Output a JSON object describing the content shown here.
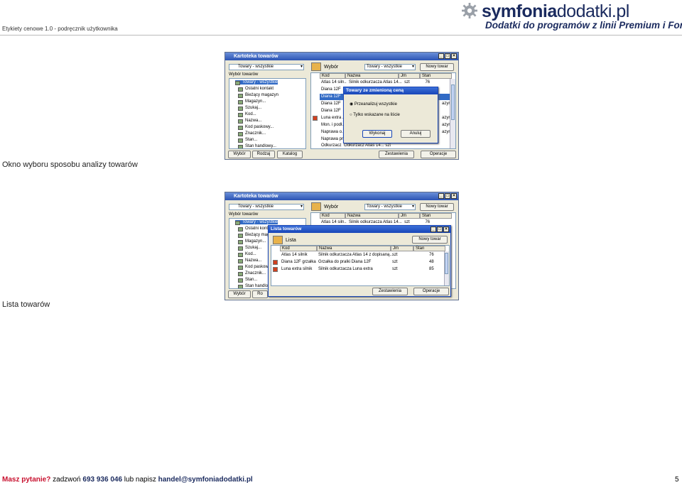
{
  "header": {
    "doc_title": "Etykiety cenowe 1.0  - podręcznik użytkownika",
    "logo_brand_bold": "symfonia",
    "logo_brand_thin": "dodatki.pl",
    "logo_tagline": "Dodatki do programów z linii Premium i Forte"
  },
  "captions": {
    "first": "Okno wyboru sposobu analizy towarów",
    "second": "Lista towarów"
  },
  "footer": {
    "question": "Masz pytanie?",
    "call_text": "zadzwoń",
    "phone": "693 936 046",
    "or_text": "lub napisz",
    "email": "handel@symfoniadodatki.pl",
    "page_number": "5"
  },
  "screenshot1": {
    "window_title": "Kartoteka towarów",
    "filter_combo": "Towary - wszystkie",
    "label_wybor_towarow": "Wybór towarów",
    "tree_items": [
      "Towary - wszystkie",
      "Ostatni kontakt",
      "Bieżący magazyn",
      "Magazyn...",
      "Szukaj...",
      "Kod...",
      "Nazwa...",
      "Kod paskowy...",
      "Znacznik...",
      "Stan...",
      "Stan handlowy..."
    ],
    "right_header": "Wybór",
    "right_combo": "Towary - wszystkie",
    "new_button": "Nowy towar",
    "columns": [
      "Kod",
      "Nazwa",
      "Jm",
      "Stan"
    ],
    "rows": [
      {
        "kod": "Atlas 14 siln..",
        "nazwa": "Silnik odkurzacza Atlas 14...",
        "jm": "szt",
        "stan": "76"
      },
      {
        "kod": "Diana 12F",
        "nazwa": "",
        "jm": "",
        "stan": ""
      },
      {
        "kod": "Diana 12F",
        "nazwa": "",
        "jm": "",
        "stan": ""
      },
      {
        "kod": "Diana 12F",
        "nazwa": "",
        "jm": "",
        "stan": ""
      },
      {
        "kod": "Diana 12F",
        "nazwa": "",
        "jm": "",
        "stan": ""
      },
      {
        "kod": "Luna extra ..",
        "nazwa": "",
        "jm": "",
        "stan": ""
      },
      {
        "kod": "Mon. i podł...",
        "nazwa": "",
        "jm": "",
        "stan": ""
      },
      {
        "kod": "Naprawa o...",
        "nazwa": "",
        "jm": "",
        "stan": ""
      },
      {
        "kod": "Naprawa pr...",
        "nazwa": "",
        "jm": "",
        "stan": ""
      },
      {
        "kod": "Odkurzacz",
        "nazwa": "Odkurzacz Atlas 14...",
        "jm": "szt",
        "stan": ""
      }
    ],
    "right_col_fragments": [
      "azyr",
      "azyr",
      "azyr",
      "azyr"
    ],
    "dialog": {
      "title": "Towary ze zmienioną ceną",
      "option1": "Przeanalizuj wszystkie",
      "option2": "Tylko wskazane na liście",
      "ok": "Wykonaj",
      "cancel": "Anuluj"
    },
    "bottom_buttons": [
      "Wybór",
      "Rodzaj",
      "Katalog"
    ],
    "right_bottom_buttons": [
      "Zestawienia",
      "Operacje"
    ]
  },
  "screenshot2": {
    "window_title": "Kartoteka towarów",
    "filter_combo": "Towary - wszystkie",
    "label_wybor_towarow": "Wybór towarów",
    "tree_items": [
      "Towary - wszystkie",
      "Ostatni kont",
      "Bieżący mag",
      "Magazyn...",
      "Szukaj...",
      "Kod...",
      "Nazwa...",
      "Kod paskow",
      "Znacznik...",
      "Stan...",
      "Stan handlo"
    ],
    "right_header": "Wybór",
    "right_combo": "Towary - wszystkie",
    "new_button": "Nowy towar",
    "columns": [
      "Kod",
      "Nazwa",
      "Jm",
      "Stan"
    ],
    "bg_row_fragments": [
      "Atlas 14 siln..",
      "Silnik odkurzacza Atlas 14...",
      "szt",
      "76"
    ],
    "list_window": {
      "title": "Lista towarów",
      "header": "Lista",
      "new_button": "Nowy towar",
      "columns": [
        "Kod",
        "Nazwa",
        "Jm",
        "Stan"
      ],
      "rows": [
        {
          "kod": "Atlas 14 silnik",
          "nazwa": "Silnik odkurzacza Atlas 14 z dopisaną...",
          "jm": "szt",
          "stan": "76"
        },
        {
          "kod": "Diana 12F grzałka",
          "nazwa": "Grzałka do pralki Diana 12F",
          "jm": "szt",
          "stan": "48"
        },
        {
          "kod": "Luna extra silnik",
          "nazwa": "Silnik odkurzacza Luna extra",
          "jm": "szt",
          "stan": "85"
        }
      ],
      "bottom_buttons": [
        "Zestawienia",
        "Operacje"
      ]
    },
    "bottom_buttons": [
      "Wybór",
      "Ro"
    ]
  },
  "colors": {
    "brand": "#1a2a5e",
    "accent_red": "#c8102e",
    "xp_title": "#2c54b4",
    "xp_face": "#ece9d8"
  }
}
